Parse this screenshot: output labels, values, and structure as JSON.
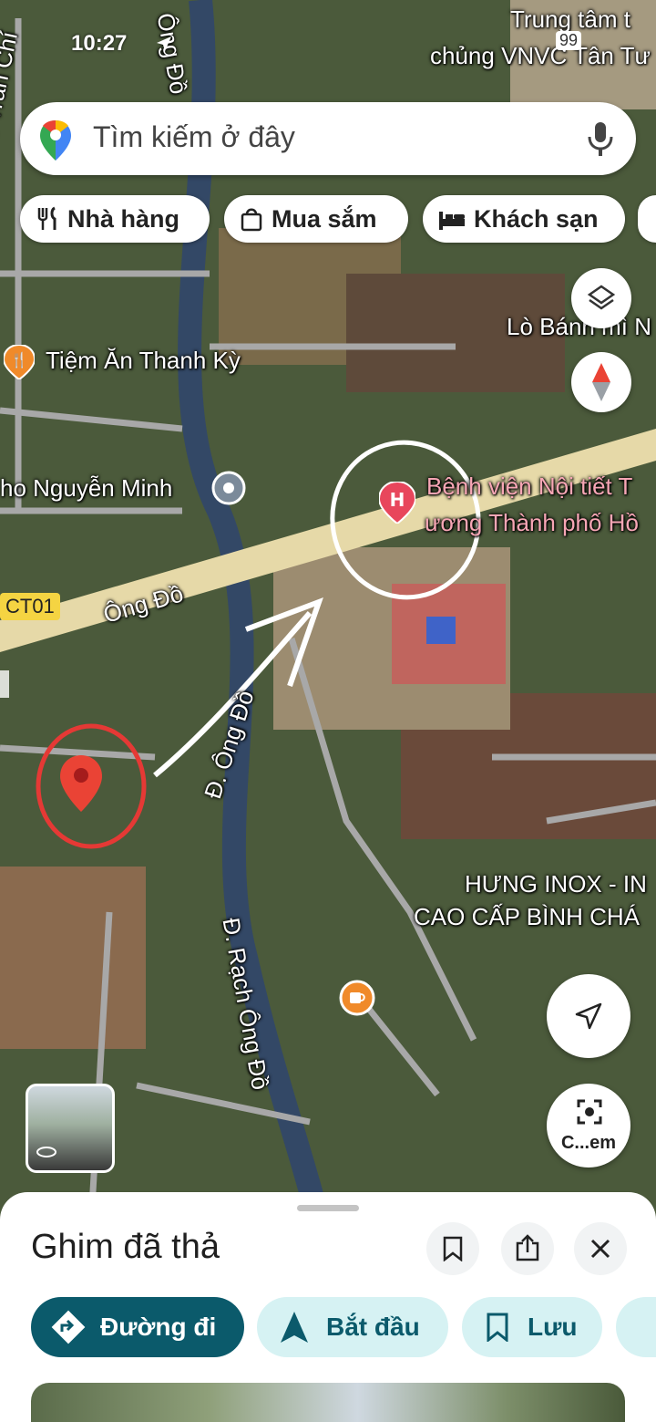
{
  "status": {
    "time": "10:27"
  },
  "search": {
    "placeholder": "Tìm kiếm ở đây"
  },
  "chips": [
    {
      "label": "Nhà hàng",
      "icon": "fork-knife-icon"
    },
    {
      "label": "Mua sắm",
      "icon": "shopping-bag-icon"
    },
    {
      "label": "Khách sạn",
      "icon": "bed-icon"
    }
  ],
  "map_labels": {
    "vnvc_1": "Trung tâm t",
    "vnvc_2": "chủng VNVC Tân Tư",
    "road_badge": "99",
    "vo_tran_chi": "Đ. Võ Trần Chí",
    "ong_do_top": "Ông Đồ",
    "banh_mi": "Lò Bánh mì N",
    "tiem_an": "Tiệm Ăn Thanh Kỳ",
    "nguyen_minh": "ho Nguyễn Minh",
    "hospital_1": "Bệnh viện Nội tiết T",
    "hospital_2": "ương Thành phố Hồ",
    "ct01": "CT01",
    "ong_do_road": "Ông Đồ",
    "d_ong_do": "Đ. Ông Đồ",
    "hung_inox_1": "HƯNG INOX - IN",
    "hung_inox_2": "CAO CẤP BÌNH CHÁ",
    "rach_ong_do": "Đ. Rạch Ông Đồ",
    "street_view_btn": "C...em"
  },
  "sheet": {
    "title": "Ghim đã thả",
    "actions": [
      {
        "label": "Đường đi"
      },
      {
        "label": "Bắt đầu"
      },
      {
        "label": "Lưu"
      }
    ]
  },
  "colors": {
    "primary": "#0b5a6b",
    "secondary": "#d6f2f3",
    "pin": "#ea4335"
  }
}
